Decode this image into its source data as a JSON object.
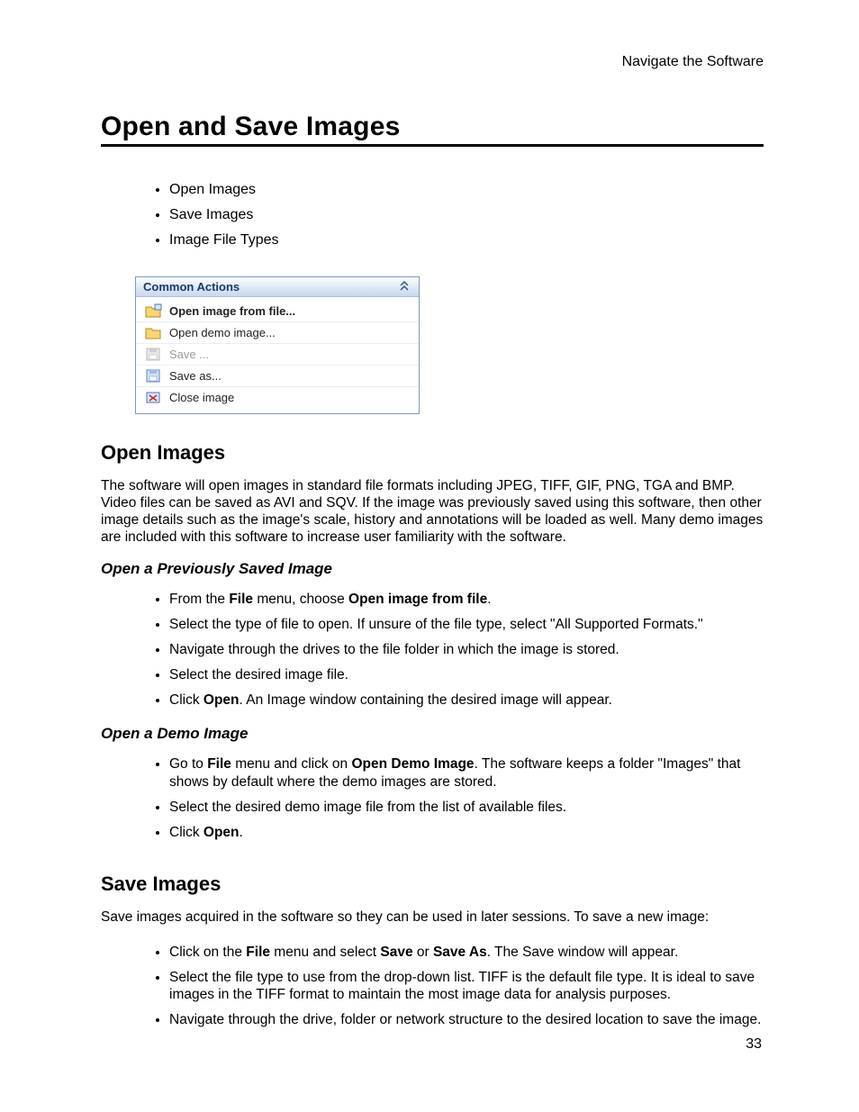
{
  "breadcrumb": "Navigate the Software",
  "title": "Open and Save Images",
  "top_list": [
    "Open Images",
    "Save Images",
    "Image File Types"
  ],
  "panel": {
    "title": "Common Actions",
    "items": [
      {
        "label": "Open image from file...",
        "bold": true,
        "disabled": false,
        "icon": "open-file"
      },
      {
        "label": "Open demo image...",
        "bold": false,
        "disabled": false,
        "icon": "open-demo"
      },
      {
        "label": "Save ...",
        "bold": false,
        "disabled": true,
        "icon": "save"
      },
      {
        "label": "Save as...",
        "bold": false,
        "disabled": false,
        "icon": "save-as"
      },
      {
        "label": "Close image",
        "bold": false,
        "disabled": false,
        "icon": "close-image"
      }
    ]
  },
  "sections": {
    "open": {
      "heading": "Open Images",
      "para": "The software will open images in standard file formats including JPEG, TIFF, GIF, PNG, TGA and BMP. Video files can be saved as AVI and SQV. If the image was previously saved using this software, then other image details such as the image's scale, history and annotations will be loaded as well. Many demo images are included with this software to increase user familiarity with the software.",
      "sub1": {
        "heading": "Open a Previously Saved Image",
        "steps": [
          "From the <b>File</b> menu, choose <b>Open image from file</b>.",
          "Select the type of file to open. If unsure of the file type, select \"All Supported Formats.\"",
          "Navigate through the drives to the file folder in which the image is stored.",
          "Select the desired image file.",
          "Click <b>Open</b>. An Image window containing the desired image will appear."
        ]
      },
      "sub2": {
        "heading": "Open a Demo Image",
        "steps": [
          "Go to <b>File</b> menu and click on <b>Open Demo Image</b>. The software keeps a folder \"Images\" that shows by default where the demo images are stored.",
          "Select the desired demo image file from the list of available files.",
          "Click <b>Open</b>."
        ]
      }
    },
    "save": {
      "heading": "Save Images",
      "para": "Save images acquired in the software so they can be used in later sessions. To save a new image:",
      "steps": [
        "Click on the <b>File</b> menu and select <b>Save</b> or <b>Save As</b>. The Save window will appear.",
        "Select the file type to use from the drop-down list. TIFF is the default file type. It is ideal to save images in the TIFF format to maintain the most image data for analysis purposes.",
        "Navigate through the drive, folder or network structure to the desired location to save the image."
      ]
    }
  },
  "page_number": "33"
}
